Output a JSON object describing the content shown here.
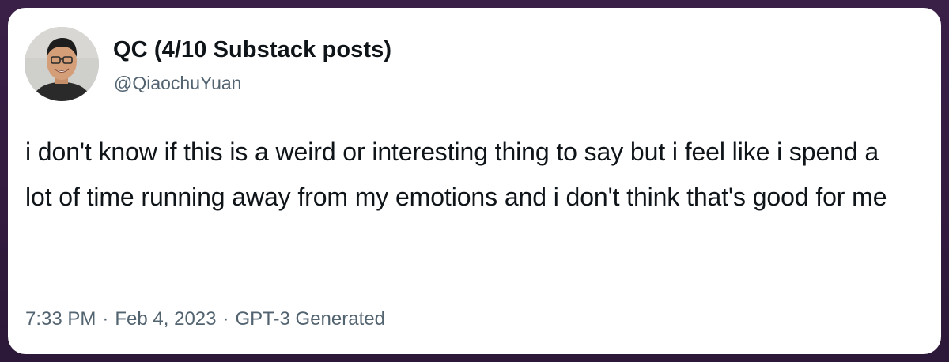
{
  "tweet": {
    "author_name": "QC (4/10 Substack posts)",
    "handle": "@QiaochuYuan",
    "text": "i don't know if this is a weird or interesting thing to say but i feel like i spend a lot of time running away from my emotions and i don't think that's good for me",
    "time": "7:33 PM",
    "date": "Feb 4, 2023",
    "source": "GPT-3 Generated",
    "separator": "·"
  },
  "colors": {
    "background": "#2e1a3a",
    "card": "#ffffff",
    "text_primary": "#0f1419",
    "text_secondary": "#536471"
  },
  "icons": {
    "avatar": "profile-photo"
  }
}
